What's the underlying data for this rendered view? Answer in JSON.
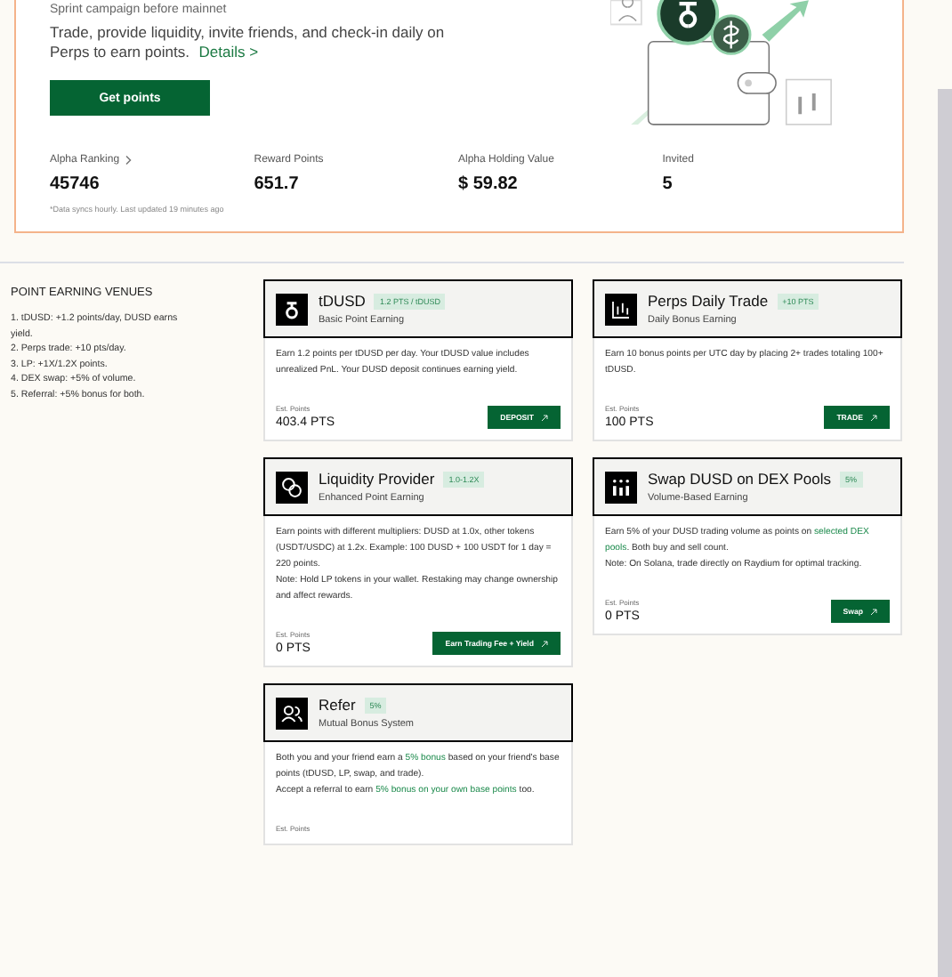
{
  "hero": {
    "kicker": "Sprint campaign before mainnet",
    "text": "Trade, provide liquidity, invite friends, and check-in daily on Perps to earn points.",
    "details_link": "Details >",
    "button": "Get points",
    "stats": [
      {
        "label": "Alpha Ranking",
        "has_arrow": true,
        "value": "45746"
      },
      {
        "label": "Reward Points",
        "has_arrow": false,
        "value": "651.7"
      },
      {
        "label": "Alpha Holding Value",
        "has_arrow": false,
        "value": "$ 59.82"
      },
      {
        "label": "Invited",
        "has_arrow": false,
        "value": "5"
      }
    ],
    "note": "*Data syncs hourly. Last updated 19 minutes ago"
  },
  "venues": {
    "title": "POINT EARNING VENUES",
    "items": [
      "1. tDUSD: +1.2 points/day, DUSD earns yield.",
      "2. Perps trade: +10 pts/day.",
      "3. LP: +1X/1.2X points.",
      "4. DEX swap: +5% of volume.",
      "5. Referral: +5% bonus for both."
    ]
  },
  "cards": [
    {
      "kind": "token",
      "title": "tDUSD",
      "badge": "1.2 PTS / tDUSD",
      "subtitle": "Basic Point Earning",
      "lines": [
        [
          {
            "text": "Earn 1.2 points per tDUSD per day. Your tDUSD value includes unrealized PnL. Your DUSD deposit continues earning yield.",
            "highlight": false
          }
        ]
      ],
      "est_label": "Est. Points",
      "est_value": "403.4 PTS",
      "button": "DEPOSIT"
    },
    {
      "kind": "chart",
      "title": "Perps Daily Trade",
      "badge": "+10 PTS",
      "subtitle": "Daily Bonus Earning",
      "lines": [
        [
          {
            "text": "Earn 10 bonus points per UTC day by placing 2+ trades totaling 100+ tDUSD.",
            "highlight": false
          }
        ]
      ],
      "est_label": "Est. Points",
      "est_value": "100 PTS",
      "button": "TRADE"
    },
    {
      "kind": "coins",
      "title": "Liquidity Provider",
      "badge": "1.0-1.2X",
      "subtitle": "Enhanced Point Earning",
      "lines": [
        [
          {
            "text": "Earn points with different multipliers: DUSD at 1.0x, other tokens (USDT/USDC) at 1.2x. Example: 100 DUSD + 100 USDT for 1 day = 220 points.",
            "highlight": false
          }
        ],
        [
          {
            "text": "Note: Hold LP tokens in your wallet. Restaking may change ownership and affect rewards.",
            "highlight": false
          }
        ]
      ],
      "est_label": "Est. Points",
      "est_value": "0 PTS",
      "button": "Earn Trading Fee + Yield"
    },
    {
      "kind": "pools",
      "title": "Swap DUSD on DEX Pools",
      "badge": "5%",
      "subtitle": "Volume-Based Earning",
      "lines": [
        [
          {
            "text": "Earn 5% of your DUSD trading volume as points on ",
            "highlight": false
          },
          {
            "text": "selected DEX pools",
            "highlight": true
          },
          {
            "text": ". Both buy and sell count.",
            "highlight": false
          }
        ],
        [
          {
            "text": "Note: On Solana, trade directly on Raydium for optimal tracking.",
            "highlight": false
          }
        ]
      ],
      "est_label": "Est. Points",
      "est_value": "0 PTS",
      "button": "Swap"
    },
    {
      "kind": "people",
      "title": "Refer",
      "badge": "5%",
      "subtitle": "Mutual Bonus System",
      "lines": [
        [
          {
            "text": "Both you and your friend earn a ",
            "highlight": false
          },
          {
            "text": "5% bonus",
            "highlight": true
          },
          {
            "text": " based on your friend's base points (tDUSD, LP, swap, and trade).",
            "highlight": false
          }
        ],
        [
          {
            "text": "Accept a referral to earn ",
            "highlight": false
          },
          {
            "text": "5% bonus on your own base points",
            "highlight": true
          },
          {
            "text": " too.",
            "highlight": false
          }
        ]
      ],
      "est_label": "Est. Points"
    }
  ]
}
